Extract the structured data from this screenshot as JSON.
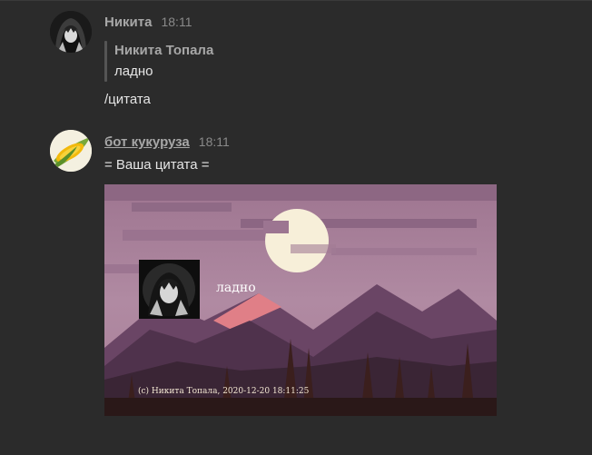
{
  "messages": [
    {
      "author": "Никита",
      "time": "18:11",
      "quote": {
        "author": "Никита Топала",
        "text": "ладно"
      },
      "text": "/цитата"
    },
    {
      "author": "бот кукуруза",
      "time": "18:11",
      "text": "= Ваша цитата ="
    }
  ],
  "quote_card": {
    "quote_text": "ладно",
    "caption": "(c) Никита Топала, 2020-12-20 18:11:25",
    "palette": {
      "sky": "#a57a97",
      "moon": "#f7efd9",
      "peak": "#e07f87",
      "mountains": "#5e3c5a",
      "trees": "#3b1f1d"
    }
  },
  "icons": {
    "user_avatar": "anime-girl-avatar-icon",
    "bot_avatar": "corn-avatar-icon"
  },
  "colors": {
    "background": "#2b2b2b",
    "username": "#a7a7a7",
    "timestamp": "#8a8a8a",
    "text": "#e6e6e6"
  }
}
